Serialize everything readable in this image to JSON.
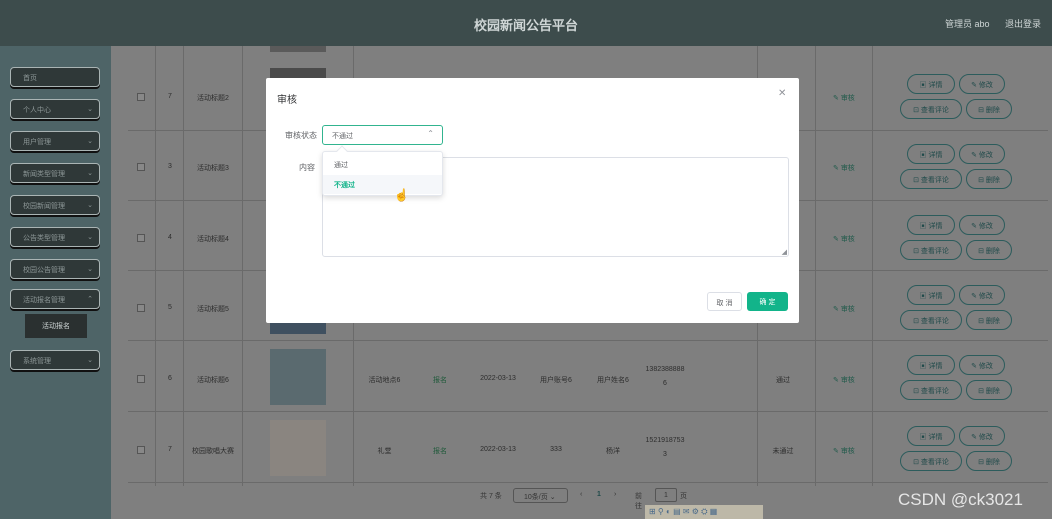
{
  "header": {
    "title": "校园新闻公告平台",
    "admin_label": "管理员 abo",
    "logout_label": "退出登录"
  },
  "sidebar": {
    "items": [
      {
        "label": "首页",
        "has_arrow": false
      },
      {
        "label": "个人中心",
        "has_arrow": true
      },
      {
        "label": "用户管理",
        "has_arrow": true
      },
      {
        "label": "新闻类型管理",
        "has_arrow": true
      },
      {
        "label": "校园新闻管理",
        "has_arrow": true
      },
      {
        "label": "公告类型管理",
        "has_arrow": true
      },
      {
        "label": "校园公告管理",
        "has_arrow": true
      },
      {
        "label": "活动报名管理",
        "has_arrow": true
      },
      {
        "label": "系统管理",
        "has_arrow": true
      }
    ],
    "submenu_label": "活动报名"
  },
  "table": {
    "rows": [
      {
        "num": "7",
        "title": "活动标题2"
      },
      {
        "num": "3",
        "title": "活动标题3"
      },
      {
        "num": "4",
        "title": "活动标题4"
      },
      {
        "num": "5",
        "title": "活动标题5"
      },
      {
        "num": "6",
        "title": "活动标题6",
        "location": "活动地点6",
        "pass_status": "报名",
        "date": "2022-03-13",
        "account": "用户账号6",
        "name": "用户姓名6",
        "phone": "13823888886",
        "audit_result": "通过"
      },
      {
        "num": "7",
        "title": "校园歌唱大赛",
        "location": "礼堂",
        "pass_status": "报名",
        "date": "2022-03-13",
        "account": "333",
        "name": "杨洋",
        "phone": "15219187533",
        "audit_result": "未通过"
      }
    ],
    "audit_link": "审核",
    "actions": {
      "detail": "详情",
      "edit": "修改",
      "comment": "查看评论",
      "delete": "删除"
    }
  },
  "pager": {
    "total": "共 7 条",
    "page_size": "10条/页",
    "current_page": "1",
    "goto_label": "前往",
    "goto_value": "1",
    "page_unit": "页"
  },
  "dialog": {
    "title": "审核",
    "status_label": "审核状态",
    "status_value": "不通过",
    "content_label": "内容",
    "cancel_label": "取 消",
    "confirm_label": "确 定",
    "options": [
      "通过",
      "不通过"
    ]
  },
  "watermark": "CSDN @ck3021"
}
